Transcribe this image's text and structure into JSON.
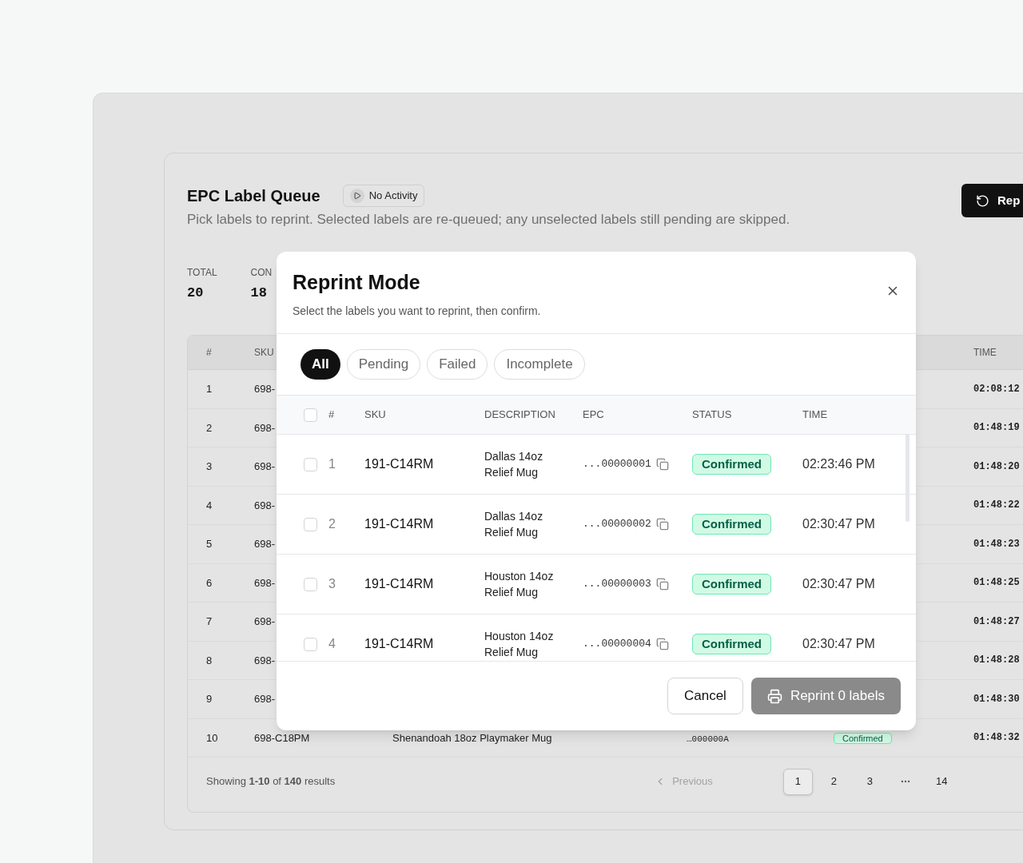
{
  "header": {
    "title": "EPC Label Queue",
    "badge": "No Activity",
    "subtitle": "Pick labels to reprint. Selected labels are re-queued; any unselected labels still pending are skipped.",
    "action": "Rep"
  },
  "stats": [
    {
      "label": "TOTAL",
      "value": "20"
    },
    {
      "label": "CON",
      "value": "18"
    }
  ],
  "table": {
    "columns": [
      "#",
      "SKU",
      "TIME"
    ],
    "rows": [
      {
        "num": "1",
        "sku": "698-",
        "time": "02:08:12"
      },
      {
        "num": "2",
        "sku": "698-",
        "time": "01:48:19"
      },
      {
        "num": "3",
        "sku": "698-",
        "time": "01:48:20"
      },
      {
        "num": "4",
        "sku": "698-",
        "time": "01:48:22"
      },
      {
        "num": "5",
        "sku": "698-",
        "time": "01:48:23"
      },
      {
        "num": "6",
        "sku": "698-",
        "time": "01:48:25"
      },
      {
        "num": "7",
        "sku": "698-",
        "time": "01:48:27"
      },
      {
        "num": "8",
        "sku": "698-",
        "time": "01:48:28"
      },
      {
        "num": "9",
        "sku": "698-",
        "time": "01:48:30"
      },
      {
        "num": "10",
        "sku": "698-C18PM",
        "description": "Shenandoah 18oz Playmaker Mug",
        "epc": "…000000A",
        "status": "Confirmed",
        "time": "01:48:32"
      }
    ]
  },
  "pagination": {
    "summary": "Showing **1-10** of **140** results",
    "previous": {
      "label": "Previous",
      "disabled": true
    },
    "pages": [
      {
        "kind": "page",
        "label": "1",
        "selected": true
      },
      {
        "kind": "page",
        "label": "2",
        "selected": false
      },
      {
        "kind": "page",
        "label": "3",
        "selected": false
      },
      {
        "kind": "ellipsis"
      },
      {
        "kind": "page",
        "label": "14",
        "selected": false
      }
    ]
  },
  "modal": {
    "title": "Reprint Mode",
    "subtitle": "Select the labels you want to reprint, then confirm.",
    "filters": [
      {
        "label": "All",
        "selected": true
      },
      {
        "label": "Pending",
        "selected": false
      },
      {
        "label": "Failed",
        "selected": false
      },
      {
        "label": "Incomplete",
        "selected": false
      }
    ],
    "select_all": {
      "checked": false
    },
    "columns": [
      "#",
      "SKU",
      "DESCRIPTION",
      "EPC",
      "STATUS",
      "TIME"
    ],
    "rows": [
      {
        "checked": false,
        "num": "1",
        "sku": "191-C14RM",
        "description": "Dallas 14oz Relief Mug",
        "epc": "...00000001",
        "status": "Confirmed",
        "time": "02:23:46 PM"
      },
      {
        "checked": false,
        "num": "2",
        "sku": "191-C14RM",
        "description": "Dallas 14oz Relief Mug",
        "epc": "...00000002",
        "status": "Confirmed",
        "time": "02:30:47 PM"
      },
      {
        "checked": false,
        "num": "3",
        "sku": "191-C14RM",
        "description": "Houston 14oz Relief Mug",
        "epc": "...00000003",
        "status": "Confirmed",
        "time": "02:30:47 PM"
      },
      {
        "checked": false,
        "num": "4",
        "sku": "191-C14RM",
        "description": "Houston 14oz Relief Mug",
        "epc": "...00000004",
        "status": "Confirmed",
        "time": "02:30:47 PM"
      }
    ],
    "buttons": {
      "cancel": "Cancel",
      "confirm": {
        "label": "Reprint 0 labels",
        "disabled": true
      }
    }
  }
}
